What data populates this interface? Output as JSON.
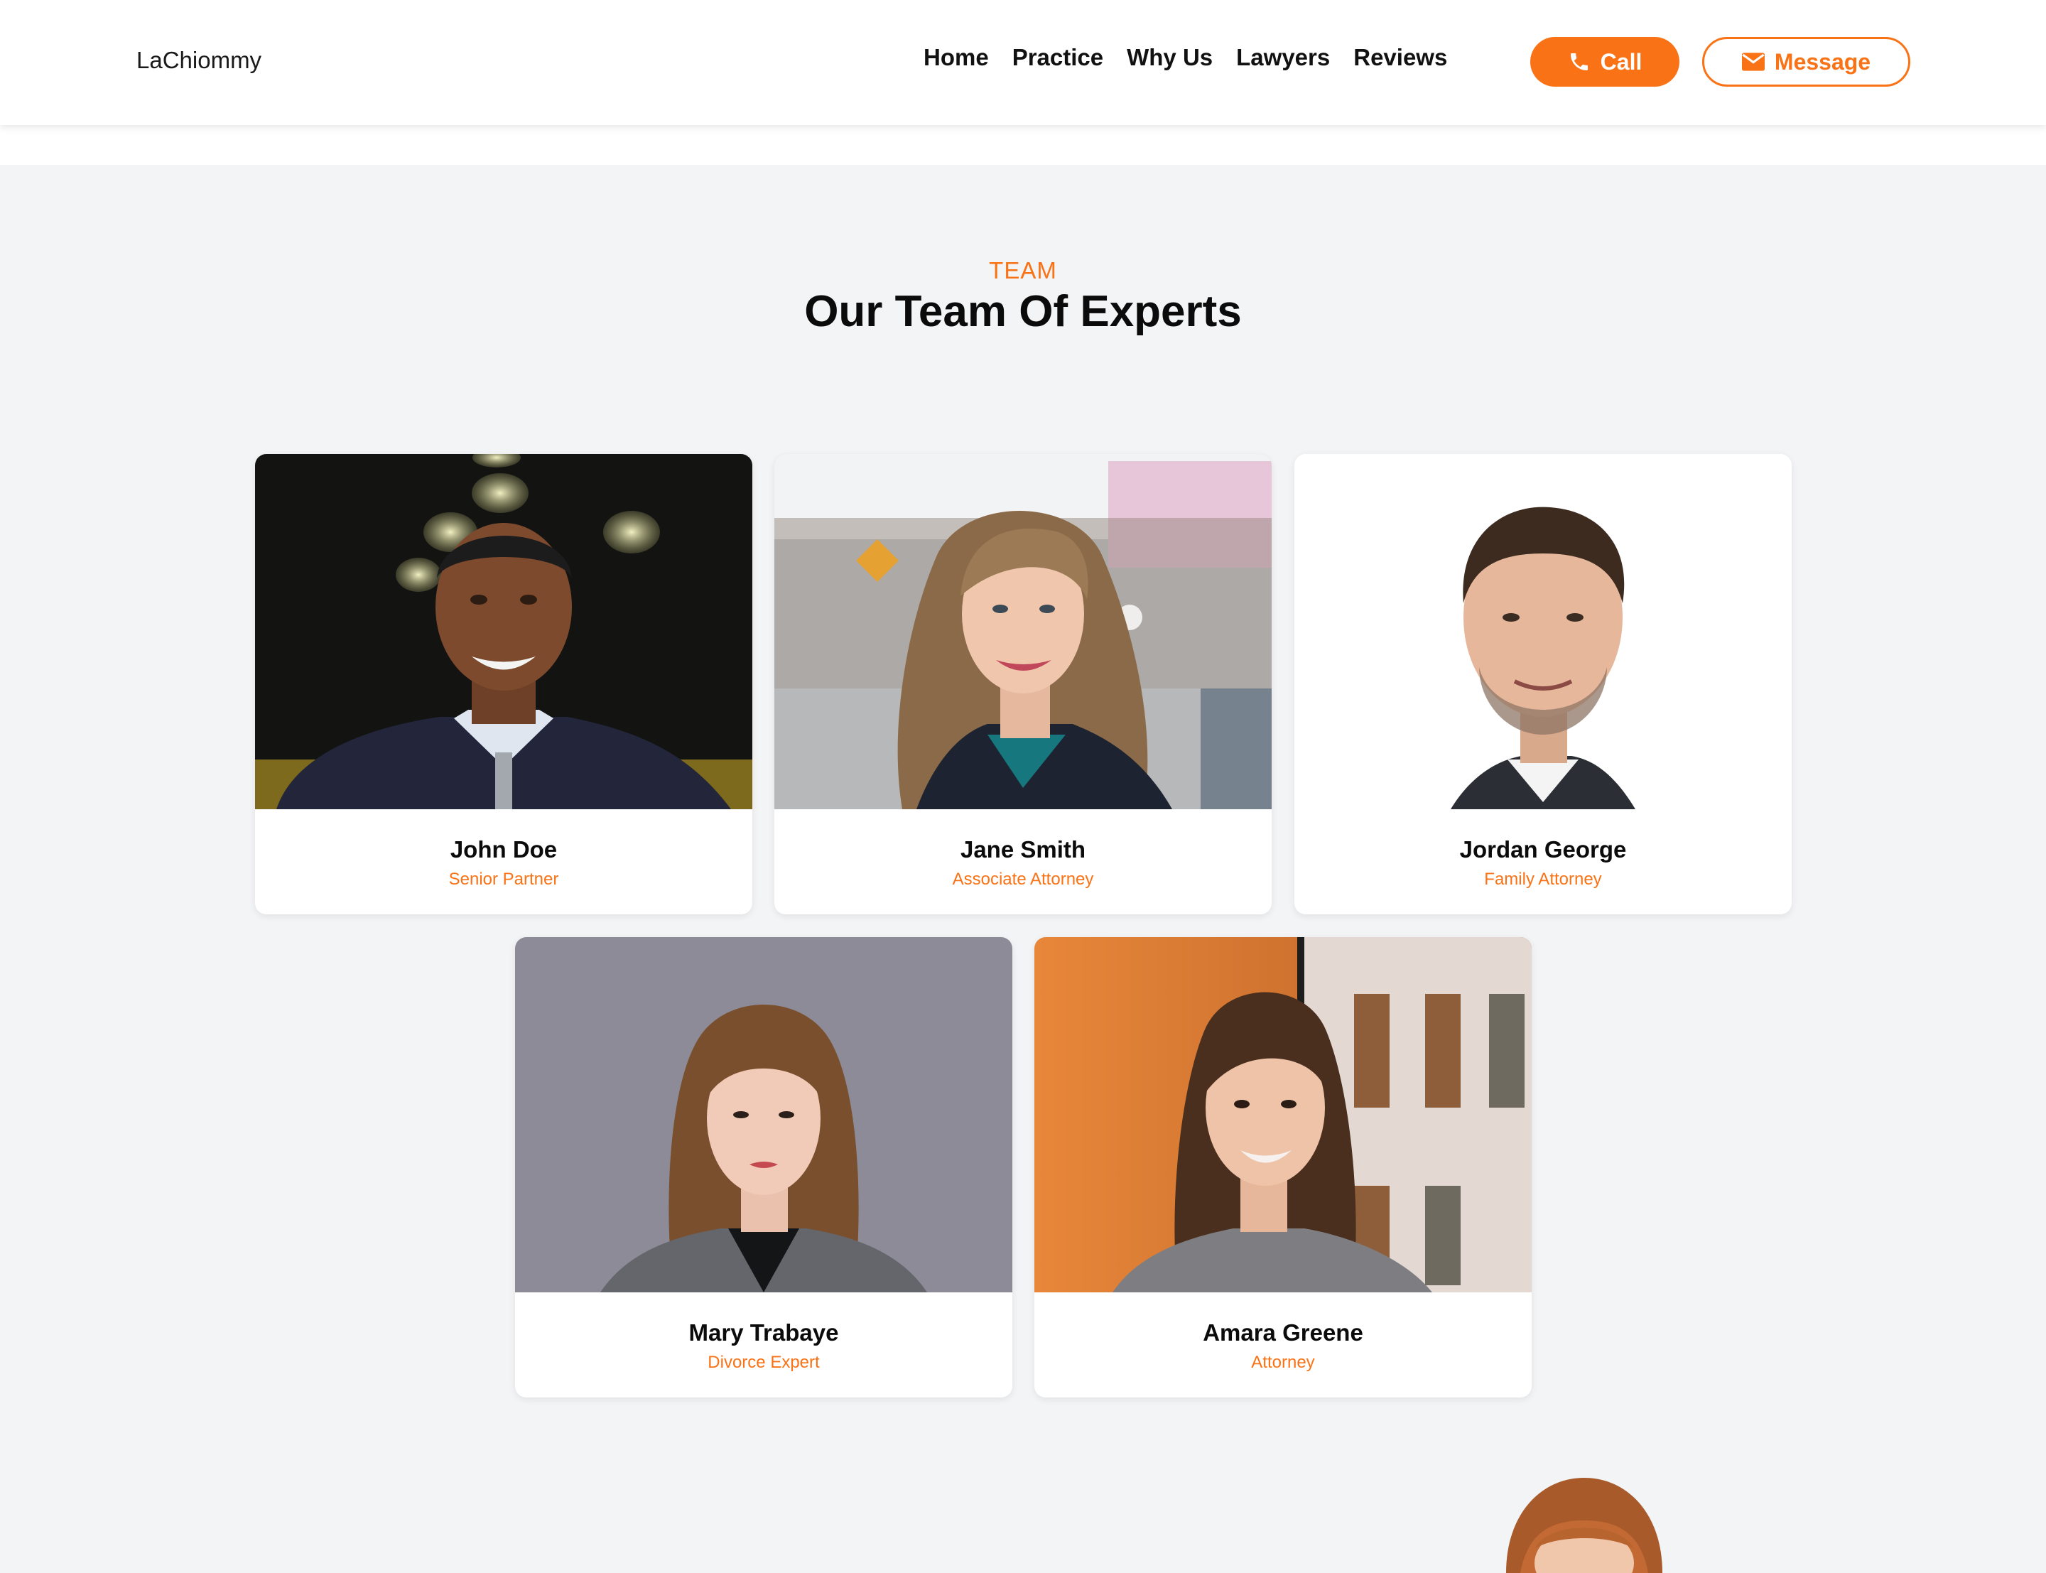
{
  "header": {
    "brand": "LaChiommy",
    "nav": [
      "Home",
      "Practice",
      "Why Us",
      "Lawyers",
      "Reviews"
    ],
    "call_label": "Call",
    "message_label": "Message"
  },
  "team": {
    "eyebrow": "TEAM",
    "title": "Our Team Of Experts",
    "members": [
      {
        "name": "John Doe",
        "role": "Senior Partner"
      },
      {
        "name": "Jane Smith",
        "role": "Associate Attorney"
      },
      {
        "name": "Jordan George",
        "role": "Family Attorney"
      },
      {
        "name": "Mary Trabaye",
        "role": "Divorce Expert"
      },
      {
        "name": "Amara Greene",
        "role": "Attorney"
      }
    ]
  },
  "colors": {
    "accent": "#f97316",
    "background": "#f3f4f6"
  },
  "icons": {
    "call": "phone-icon",
    "message": "envelope-icon"
  }
}
